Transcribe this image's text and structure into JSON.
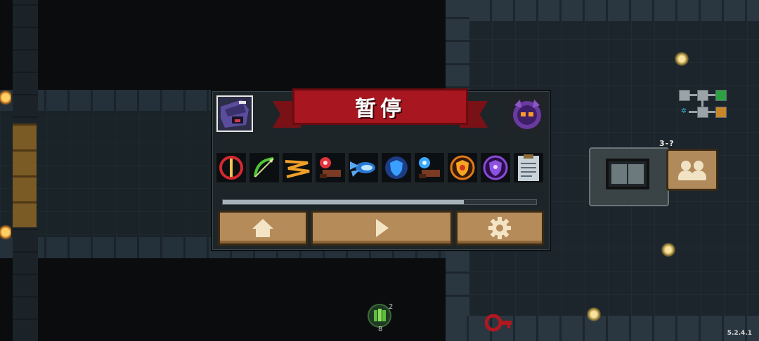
{
  "pause_menu": {
    "title": "暂停",
    "buttons": {
      "home_icon": "home-icon",
      "resume_icon": "play-icon",
      "settings_icon": "gear-icon"
    },
    "buff_icons": [
      "red-sword-ring-icon",
      "green-bow-icon",
      "lightning-bolt-icon",
      "red-orb-cannon-icon",
      "blue-energy-blast-icon",
      "blue-shield-icon",
      "blue-orb-cannon-icon",
      "orange-fire-shield-icon",
      "purple-shield-icon",
      "clipboard-icon"
    ],
    "progress": 0.77
  },
  "hud": {
    "level": "3-?",
    "weapon_count_top": "2",
    "weapon_count_bottom": "8",
    "version": "5.2.4.1"
  },
  "colors": {
    "banner_red": "#a8161f",
    "button_tan": "#b58b5a",
    "panel_bg": "#1e2528"
  }
}
